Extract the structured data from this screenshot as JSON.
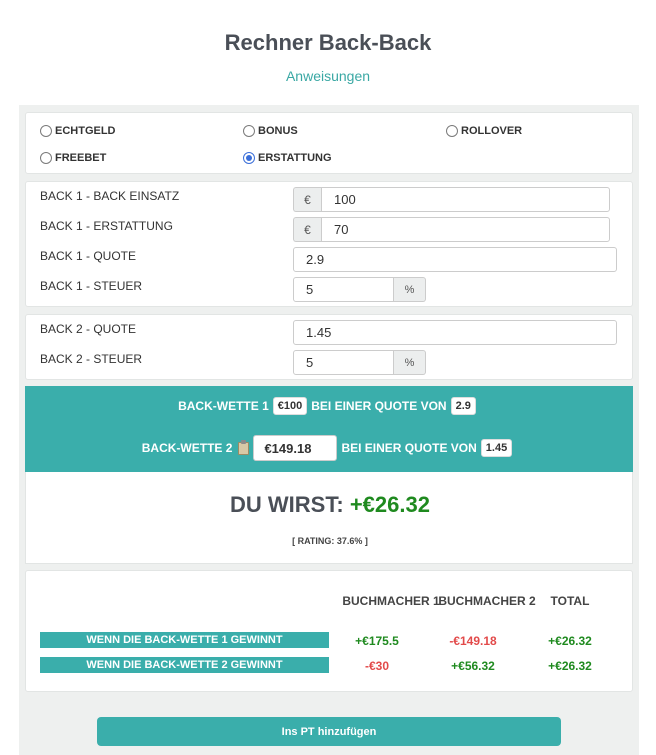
{
  "header": {
    "title": "Rechner Back-Back",
    "instructions_link": "Anweisungen"
  },
  "bet_types": [
    {
      "label": "ECHTGELD",
      "checked": false
    },
    {
      "label": "BONUS",
      "checked": false
    },
    {
      "label": "ROLLOVER",
      "checked": false
    },
    {
      "label": "FREEBET",
      "checked": false
    },
    {
      "label": "ERSTATTUNG",
      "checked": true
    }
  ],
  "back1": {
    "stake_label": "BACK 1 - BACK EINSATZ",
    "stake_prefix": "€",
    "stake_value": "100",
    "refund_label": "BACK 1 - ERSTATTUNG",
    "refund_prefix": "€",
    "refund_value": "70",
    "odds_label": "BACK 1 - QUOTE",
    "odds_value": "2.9",
    "tax_label": "BACK 1 - STEUER",
    "tax_value": "5",
    "tax_suffix": "%"
  },
  "back2": {
    "odds_label": "BACK 2 - QUOTE",
    "odds_value": "1.45",
    "tax_label": "BACK 2 - STEUER",
    "tax_value": "5",
    "tax_suffix": "%"
  },
  "summary": {
    "line1_prefix": "BACK-WETTE 1",
    "line1_stake": "€100",
    "line1_mid": "BEI EINER QUOTE VON",
    "line1_odds": "2.9",
    "line2_prefix": "BACK-WETTE 2",
    "line2_stake": "€149.18",
    "line2_mid": "BEI EINER QUOTE VON",
    "line2_odds": "1.45"
  },
  "result": {
    "label": "DU WIRST:",
    "profit": "+€26.32",
    "rating": "[ RATING: 37.6% ]"
  },
  "table": {
    "headers": [
      "BUCHMACHER 1",
      "BUCHMACHER 2",
      "TOTAL"
    ],
    "rows": [
      {
        "label": "WENN DIE BACK-WETTE 1 GEWINNT",
        "values": [
          "+€175.5",
          "-€149.18",
          "+€26.32"
        ]
      },
      {
        "label": "WENN DIE BACK-WETTE 2 GEWINNT",
        "values": [
          "-€30",
          "+€56.32",
          "+€26.32"
        ]
      }
    ]
  },
  "actions": {
    "add_label": "Ins PT hinzufügen"
  },
  "colors": {
    "accent": "#3aaeab",
    "positive": "#1f8a1f",
    "negative": "#e24a4a"
  }
}
